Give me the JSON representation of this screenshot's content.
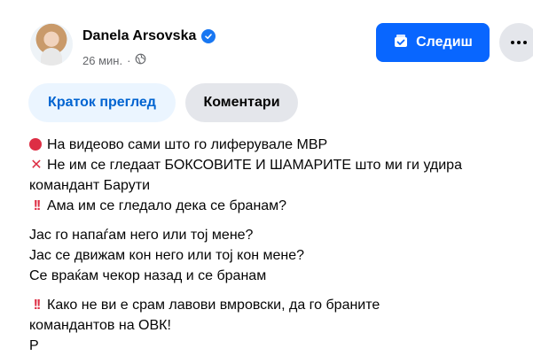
{
  "post": {
    "author": "Danela Arsovska",
    "time": "26 мин.",
    "dot": "·",
    "follow_label": "Следиш",
    "tabs": [
      "Краток преглед",
      "Коментари"
    ],
    "lines": [
      "На видеово сами што го лиферувале МВР",
      "Не им се гледаат БОКСОВИТЕ И ШАМАРИТЕ што ми ги удира",
      "командант Барути",
      "Ама им се гледало дека се бранам?",
      "Јас го напаѓам него или тој мене?",
      "Јас се движам кон него или тој кон мене?",
      "Се враќам чекор назад и се бранам",
      "Како не ви е срам лавови вмровски, да го браните",
      "командантов на ОВК!",
      "Р"
    ]
  },
  "icons": {
    "verified": "verified-badge-icon",
    "globe": "globe-icon",
    "follow": "following-icon",
    "more": "more-icon",
    "red_circle": "red-circle-icon",
    "cross": "cross-mark-icon",
    "bangs": "double-exclamation-icon"
  },
  "colors": {
    "accent": "#0866ff",
    "tab_active_bg": "#ebf5ff",
    "tab_active_text": "#0064d1",
    "secondary_bg": "#e4e6eb",
    "muted_text": "#65676b",
    "emoji_red": "#dd2e44"
  }
}
